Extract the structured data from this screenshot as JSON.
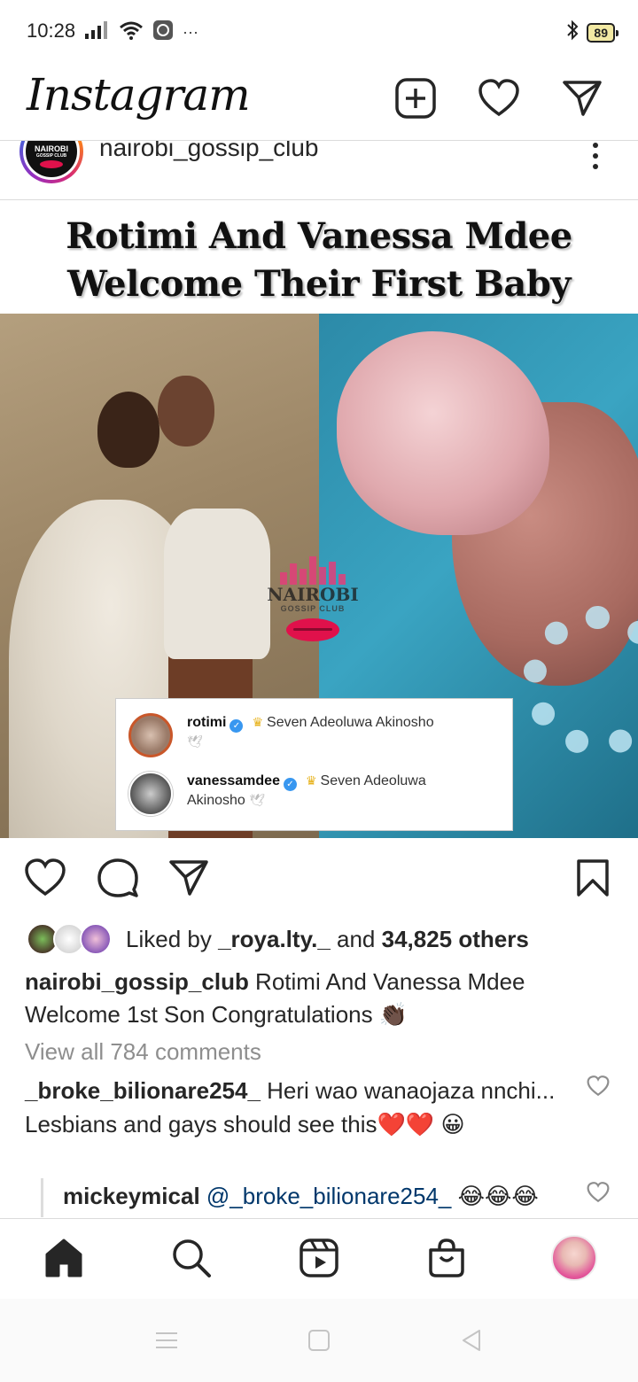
{
  "status_bar": {
    "time": "10:28",
    "battery": "89",
    "more": "···"
  },
  "header": {
    "logo": "Instagram",
    "icons": [
      "new-post-icon",
      "heart-icon",
      "direct-message-icon"
    ]
  },
  "post": {
    "username": "nairobi_gossip_club",
    "avatar_text_line1": "NAIROBI",
    "avatar_text_line2": "GOSSIP CLUB",
    "headline": "Rotimi And Vanessa Mdee Welcome Their First Baby",
    "watermark_title": "NAIROBI",
    "watermark_sub": "GOSSIP CLUB",
    "embedded_comments": [
      {
        "user": "rotimi",
        "text": "Seven Adeoluwa Akinosho"
      },
      {
        "user": "vanessamdee",
        "text": "Seven Adeoluwa Akinosho"
      }
    ]
  },
  "likes": {
    "prefix": "Liked by ",
    "user": "_roya.lty._",
    "middle": " and ",
    "count": "34,825 others"
  },
  "caption": {
    "user": "nairobi_gossip_club",
    "text": " Rotimi And Vanessa Mdee Welcome 1st Son Congratulations 👏🏿"
  },
  "view_all_comments": "View all 784 comments",
  "comments": [
    {
      "user": "_broke_bilionare254_",
      "text": " Heri wao wanaojaza nnchi... Lesbians and gays should see this❤️❤️ 😀"
    },
    {
      "user": "mickeymical",
      "mention": " @_broke_bilionare254_",
      "text": " 😂😂😂"
    }
  ],
  "bottom_nav": [
    "home-icon",
    "search-icon",
    "reels-icon",
    "shop-icon",
    "profile-avatar"
  ],
  "colors": {
    "verified": "#3897f0",
    "like_red": "#e0114b",
    "mention": "#00376b",
    "muted": "#8e8e8e"
  }
}
